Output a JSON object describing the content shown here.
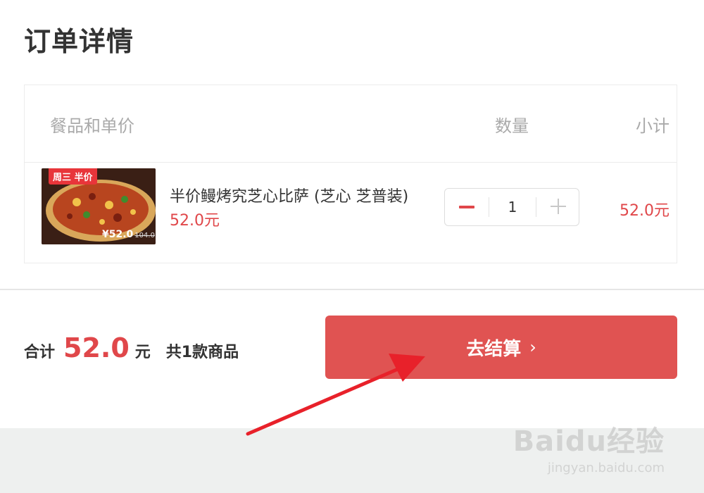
{
  "page": {
    "title": "订单详情"
  },
  "table": {
    "headers": {
      "item": "餐品和单价",
      "quantity": "数量",
      "subtotal": "小计"
    },
    "rows": [
      {
        "promo_tag": "周三 半价",
        "image_price": "¥52.0",
        "image_orig_price": "104.0",
        "name": "半价鳗烤究芝心比萨 (芝心 芝普装)",
        "price": "52.0元",
        "quantity": "1",
        "subtotal": "52.0元"
      }
    ]
  },
  "summary": {
    "total_label": "合计",
    "total_amount": "52.0",
    "total_unit": "元",
    "item_count": "共1款商品"
  },
  "checkout": {
    "label": "去结算",
    "chevron": "›"
  },
  "watermark": {
    "main": "Baidu经验",
    "sub": "jingyan.baidu.com"
  },
  "colors": {
    "accent": "#e05352",
    "price": "#e0474a",
    "arrow": "#e8212a"
  },
  "icons": {
    "minus": "minus-icon",
    "plus": "plus-icon",
    "chevron": "chevron-right-icon"
  }
}
